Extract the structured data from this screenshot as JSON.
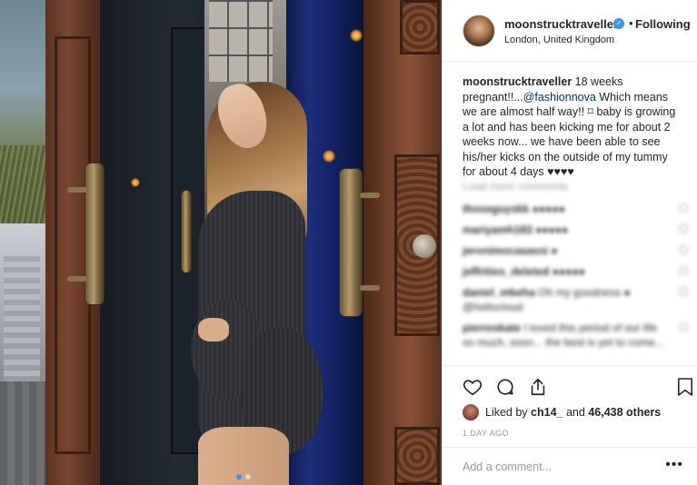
{
  "post": {
    "username": "moonstrucktraveller",
    "separator": "•",
    "follow_state": "Following",
    "location": "London, United Kingdom"
  },
  "caption": {
    "username": "moonstrucktraveller",
    "text_before_mention": "18 weeks pregnant!!...",
    "mention": "@fashionnova",
    "text_after_mention": " Which means we are almost half way!! ⌑ baby is growing a lot and has been kicking me for about 2 weeks now... we have been able to see his/her kicks on the outside of my tummy for about 4 days ♥♥♥♥"
  },
  "comments": {
    "load_more": "Load more comments",
    "items": [
      {
        "user": "thoseguyskk",
        "text": "●●●●●"
      },
      {
        "user": "mariyamh183",
        "text": "●●●●●"
      },
      {
        "user": "jeronimocasassi",
        "text": "●"
      },
      {
        "user": "jeffrities_deleted",
        "text": "●●●●●"
      },
      {
        "user": "daniel_mbeha",
        "text": "Oh my goodness ● @hellocloud"
      },
      {
        "user": "pierreskate",
        "text": "I loved this period of our life so much, soon... the best is yet to come..."
      }
    ]
  },
  "likes": {
    "prefix": "Liked by",
    "user": "ch14_",
    "middle": "and",
    "count": "46,438 others"
  },
  "time_ago": "1 DAY AGO",
  "comment_box": {
    "placeholder": "Add a comment...",
    "more": "•••"
  },
  "carousel": {
    "total": 2,
    "active_index": 0
  },
  "colors": {
    "link": "#003569",
    "active_dot": "#3897f0",
    "verified": "#3897f0"
  },
  "icons": {
    "like": "heart-icon",
    "comment": "comment-icon",
    "share": "share-icon",
    "save": "bookmark-icon",
    "verified": "verified-badge-icon",
    "more": "more-options-icon"
  }
}
